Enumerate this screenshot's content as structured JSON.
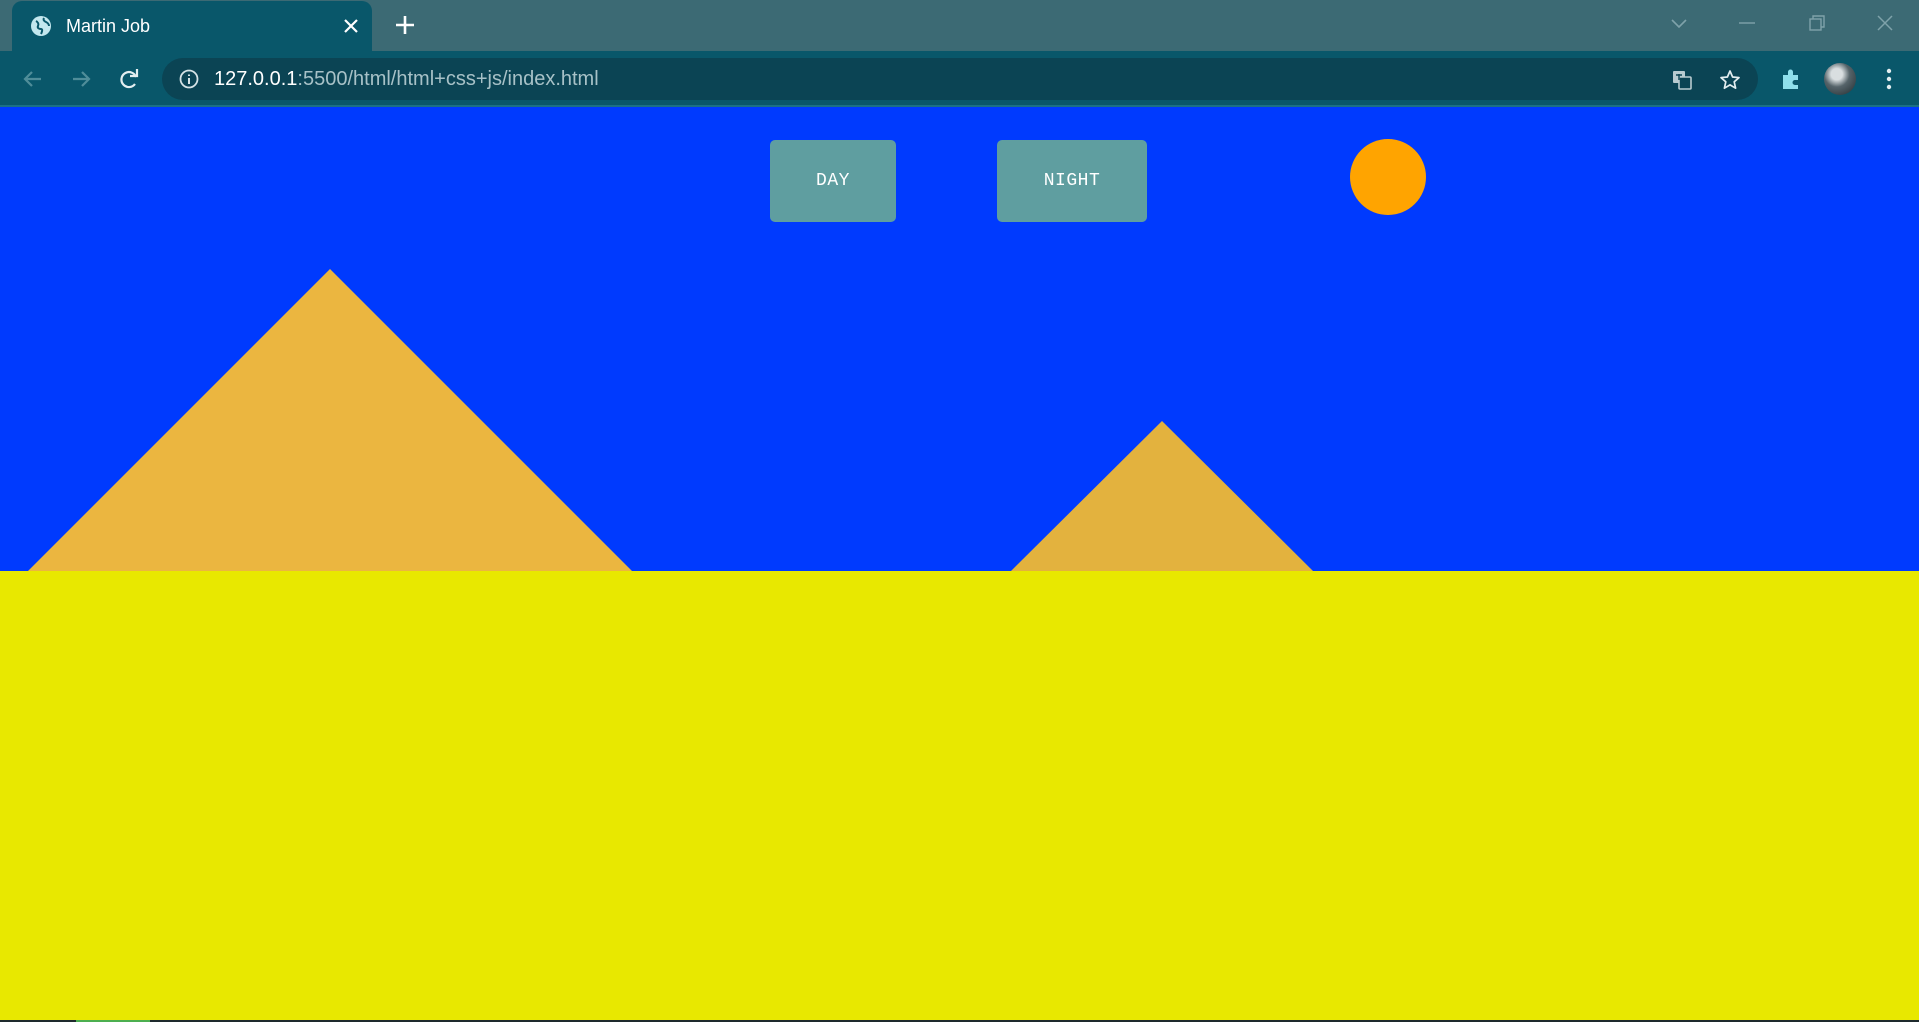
{
  "browser": {
    "tab": {
      "title": "Martin Job",
      "favicon": "globe-icon"
    },
    "toolbar": {
      "url_host": "127.0.0.1",
      "url_path": ":5500/html/html+css+js/index.html"
    }
  },
  "page": {
    "buttons": {
      "day_label": "DAY",
      "night_label": "NIGHT"
    },
    "colors": {
      "sky": "#003afe",
      "sand": "#e8e800",
      "pyramid": "#ebb640",
      "sun": "#ffa400",
      "button": "#5f9ea0"
    }
  }
}
